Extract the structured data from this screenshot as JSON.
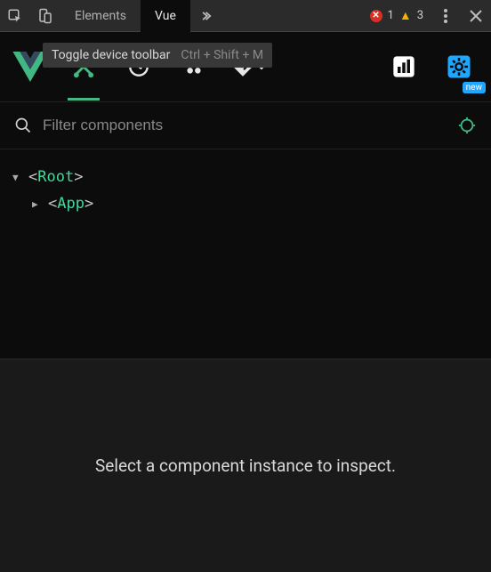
{
  "devtools": {
    "tabs": {
      "elements": "Elements",
      "vue": "Vue"
    },
    "errors": "1",
    "warnings": "3"
  },
  "tooltip": {
    "label": "Toggle device toolbar",
    "shortcut": "Ctrl + Shift + M"
  },
  "vuebar": {
    "settings_badge": "new"
  },
  "filter": {
    "placeholder": "Filter components"
  },
  "tree": {
    "root": "Root",
    "app": "App"
  },
  "details": {
    "empty": "Select a component instance to inspect."
  }
}
